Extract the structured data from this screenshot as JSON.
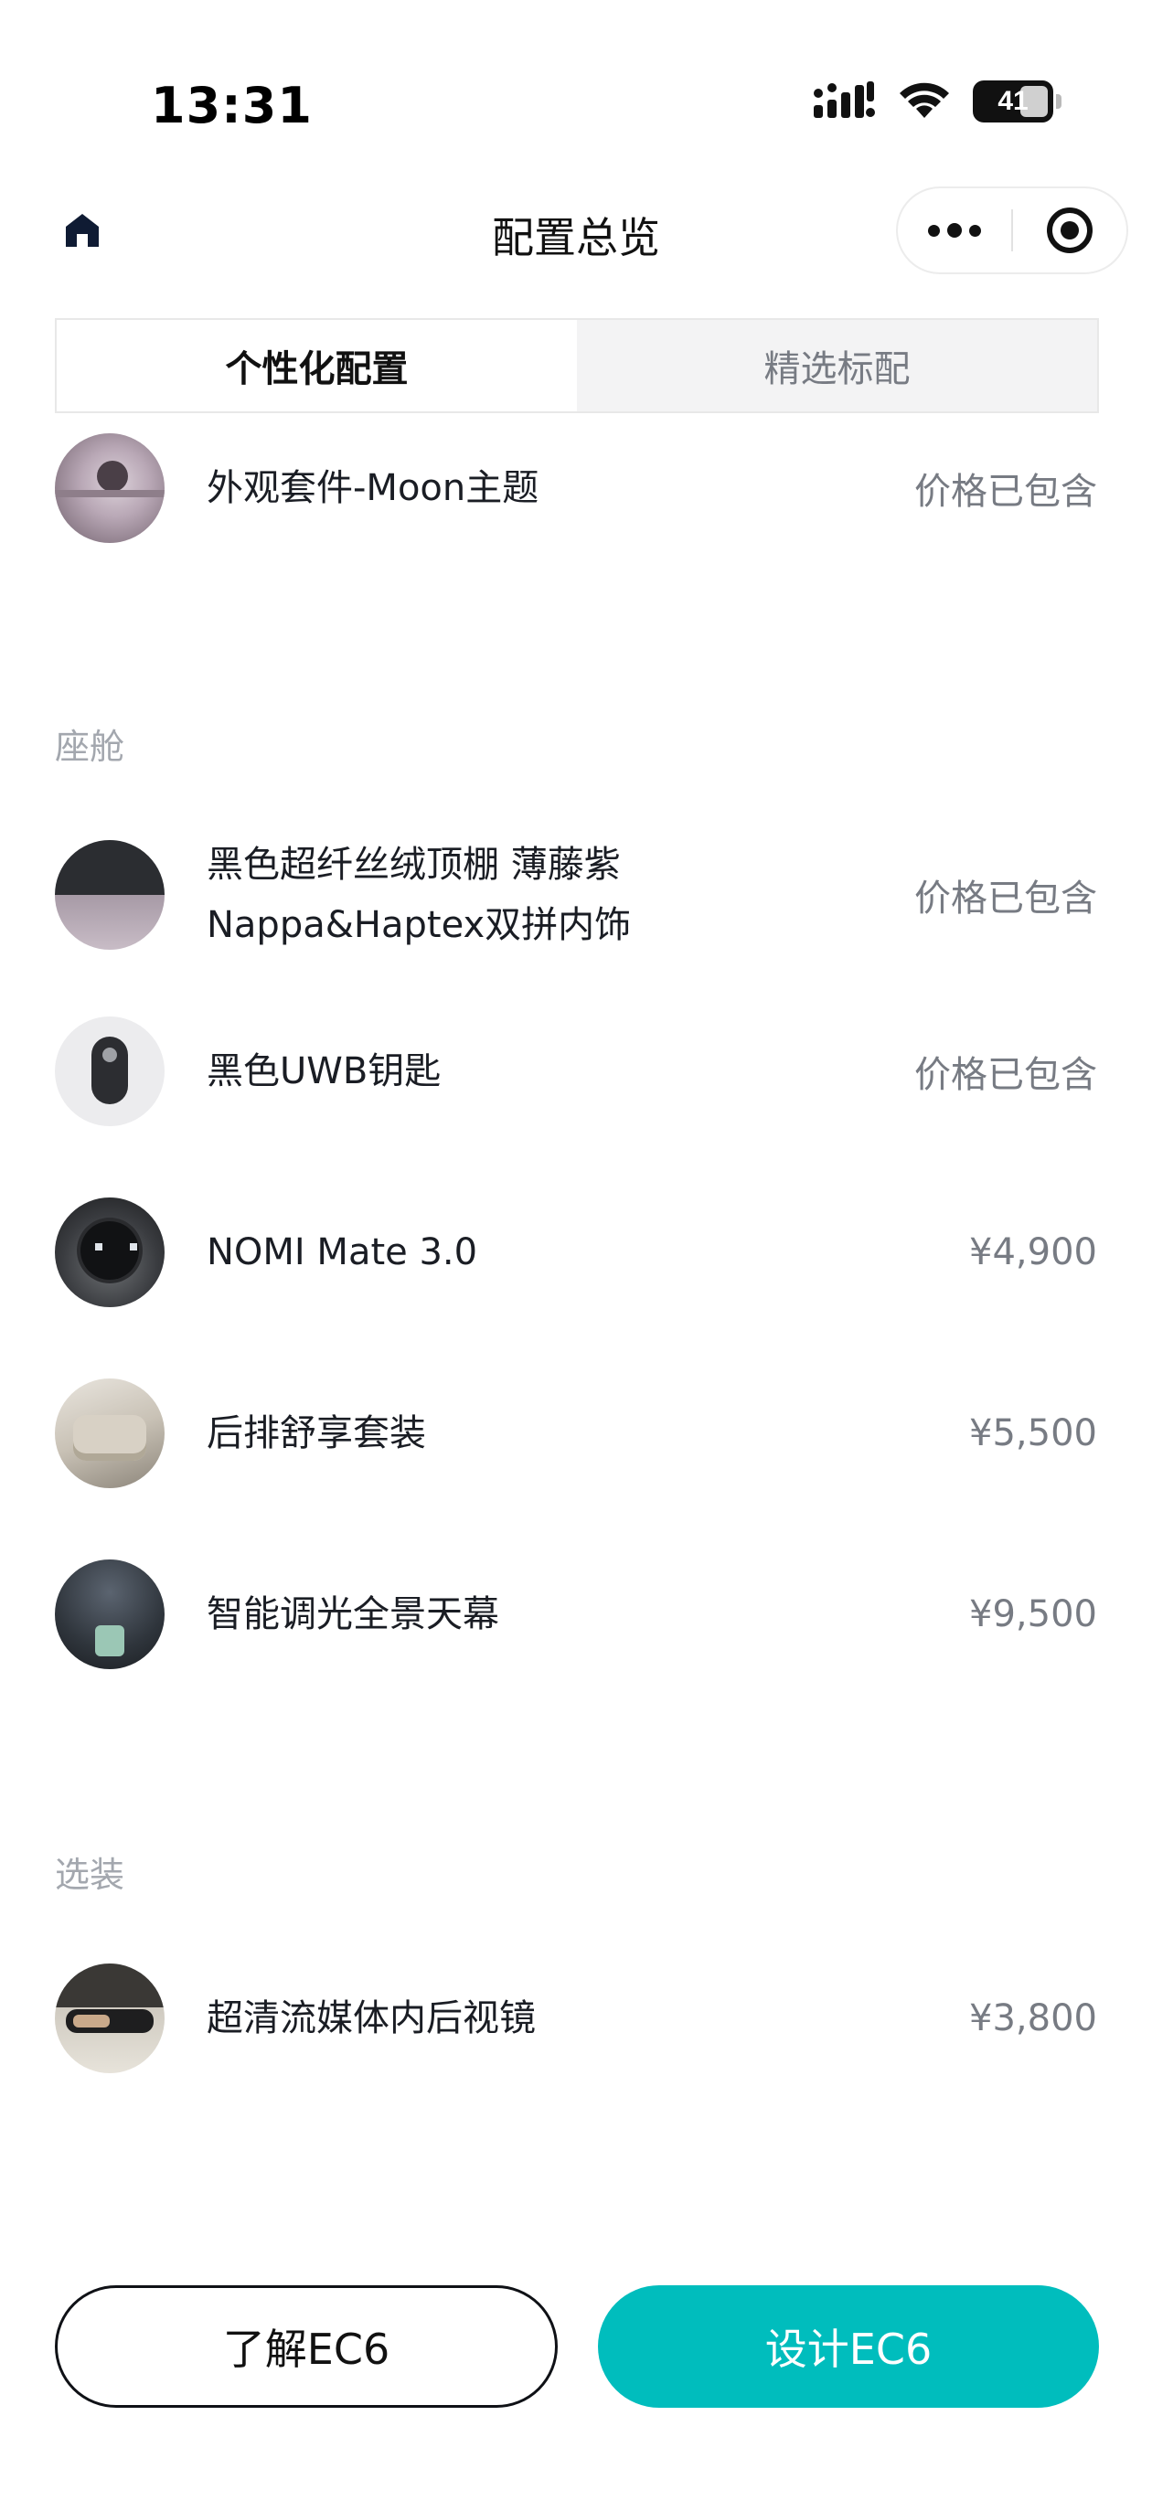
{
  "status_bar": {
    "time": "13:31",
    "battery": "41"
  },
  "nav": {
    "title": "配置总览"
  },
  "tabs": [
    {
      "label": "个性化配置",
      "active": true
    },
    {
      "label": "精选标配",
      "active": false
    }
  ],
  "exterior_items": [
    {
      "name": "外观套件-Moon主题",
      "price": "价格已包含"
    }
  ],
  "sections": {
    "cabin": "座舱",
    "optional": "选装"
  },
  "cabin_items": [
    {
      "name_line1": "黑色超纤丝绒顶棚 薄藤紫",
      "name_line2": "Nappa&Haptex双拼内饰",
      "price": "价格已包含"
    },
    {
      "name": "黑色UWB钥匙",
      "price": "价格已包含"
    },
    {
      "name": "NOMI Mate 3.0",
      "price": "¥4,900"
    },
    {
      "name": "后排舒享套装",
      "price": "¥5,500"
    },
    {
      "name": "智能调光全景天幕",
      "price": "¥9,500"
    }
  ],
  "optional_items": [
    {
      "name": "超清流媒体内后视镜",
      "price": "¥3,800"
    }
  ],
  "buttons": {
    "learn": "了解EC6",
    "design": "设计EC6"
  },
  "colors": {
    "accent": "#00bdbd",
    "text_primary": "#1a1d24",
    "text_secondary": "#777b83",
    "section_label": "#a3a7ae"
  }
}
